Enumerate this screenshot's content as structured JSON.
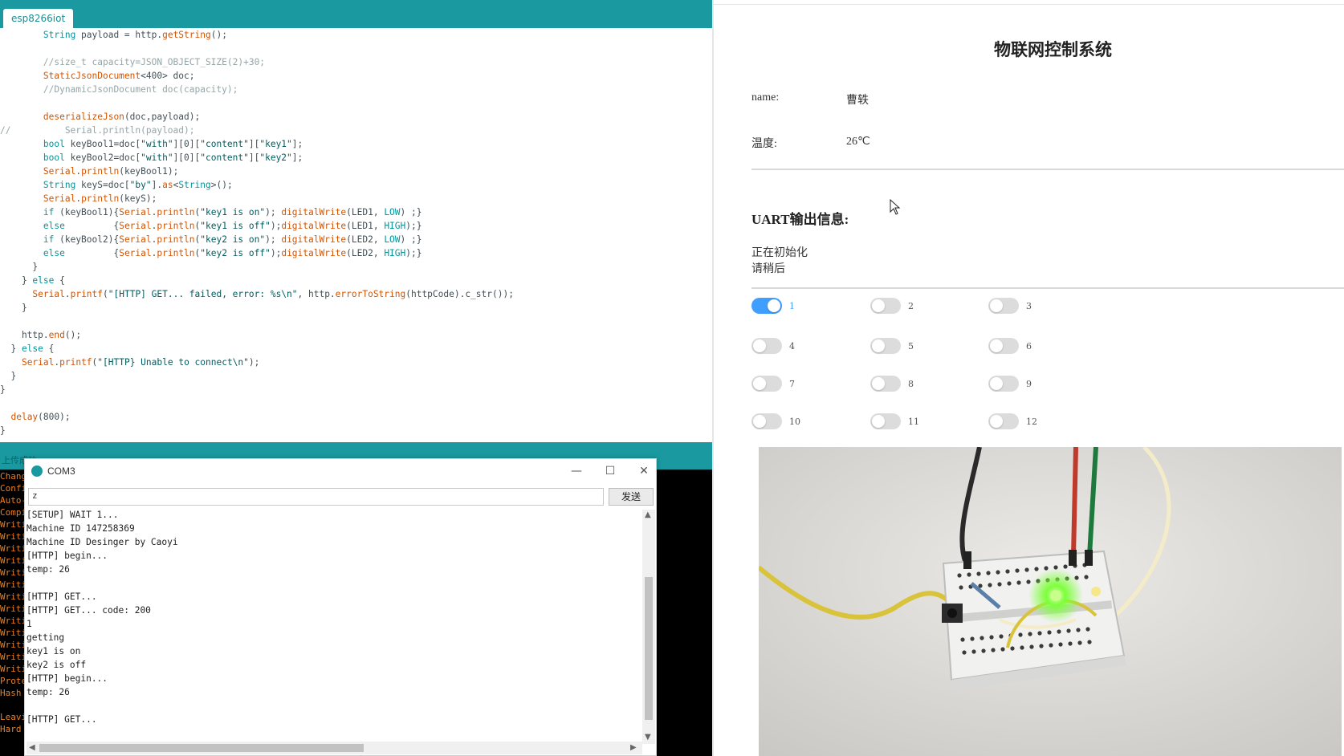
{
  "ide": {
    "tab_label": "esp8266iot",
    "status_text": "上传成功",
    "code_lines": [
      "        String payload = http.getString();",
      "",
      "        //size_t capacity=JSON_OBJECT_SIZE(2)+30;",
      "        StaticJsonDocument<400> doc;",
      "        //DynamicJsonDocument doc(capacity);",
      "",
      "        deserializeJson(doc,payload);",
      "//          Serial.println(payload);",
      "        bool keyBool1=doc[\"with\"][0][\"content\"][\"key1\"];",
      "        bool keyBool2=doc[\"with\"][0][\"content\"][\"key2\"];",
      "        Serial.println(keyBool1);",
      "        String keyS=doc[\"by\"].as<String>();",
      "        Serial.println(keyS);",
      "        if (keyBool1){Serial.println(\"key1 is on\"); digitalWrite(LED1, LOW) ;}",
      "        else         {Serial.println(\"key1 is off\");digitalWrite(LED1, HIGH);}",
      "        if (keyBool2){Serial.println(\"key2 is on\"); digitalWrite(LED2, LOW) ;}",
      "        else         {Serial.println(\"key2 is off\");digitalWrite(LED2, HIGH);}",
      "      }",
      "    } else {",
      "      Serial.printf(\"[HTTP] GET... failed, error: %s\\n\", http.errorToString(httpCode).c_str());",
      "    }",
      "",
      "    http.end();",
      "  } else {",
      "    Serial.printf(\"[HTTP} Unable to connect\\n\");",
      "  }",
      "}",
      "",
      "  delay(800);",
      "}"
    ],
    "console_lines": [
      "Chang",
      "Confi",
      "Auto-",
      "Compi",
      "Writi",
      "Writi",
      "Writi",
      "Writi",
      "Writi",
      "Writi",
      "Writi",
      "Writi",
      "Writi",
      "Writi",
      "Writi",
      "Writi",
      "Writi",
      "Prote",
      "Hash",
      "",
      "Leavi",
      "Hard"
    ]
  },
  "serial": {
    "title": "COM3",
    "input_value": "z",
    "send_label": "发送",
    "min_icon": "minimize-icon",
    "max_icon": "maximize-icon",
    "close_icon": "close-icon",
    "output_lines": [
      "[SETUP] WAIT 1...",
      "Machine ID 147258369",
      "Machine ID Desinger by Caoyi",
      "[HTTP] begin...",
      "temp: 26",
      "",
      "[HTTP] GET...",
      "[HTTP] GET... code: 200",
      "1",
      "getting",
      "key1 is on",
      "key2 is off",
      "[HTTP] begin...",
      "temp: 26",
      "",
      "[HTTP] GET..."
    ]
  },
  "web": {
    "title": "物联网控制系统",
    "name_label": "name:",
    "name_value": "曹轶",
    "temp_label": "温度:",
    "temp_value": "26℃",
    "uart_heading": "UART输出信息:",
    "uart_lines": [
      "正在初始化",
      "请稍后"
    ],
    "switches": [
      {
        "label": "1",
        "on": true
      },
      {
        "label": "2",
        "on": false
      },
      {
        "label": "3",
        "on": false
      },
      {
        "label": "4",
        "on": false
      },
      {
        "label": "5",
        "on": false
      },
      {
        "label": "6",
        "on": false
      },
      {
        "label": "7",
        "on": false
      },
      {
        "label": "8",
        "on": false
      },
      {
        "label": "9",
        "on": false
      },
      {
        "label": "10",
        "on": false
      },
      {
        "label": "11",
        "on": false
      },
      {
        "label": "12",
        "on": false
      }
    ],
    "accent_color": "#409eff"
  },
  "colors": {
    "ide_teal": "#1a9aa0",
    "console_text": "#e67e22",
    "led_green": "#7cff3a"
  }
}
